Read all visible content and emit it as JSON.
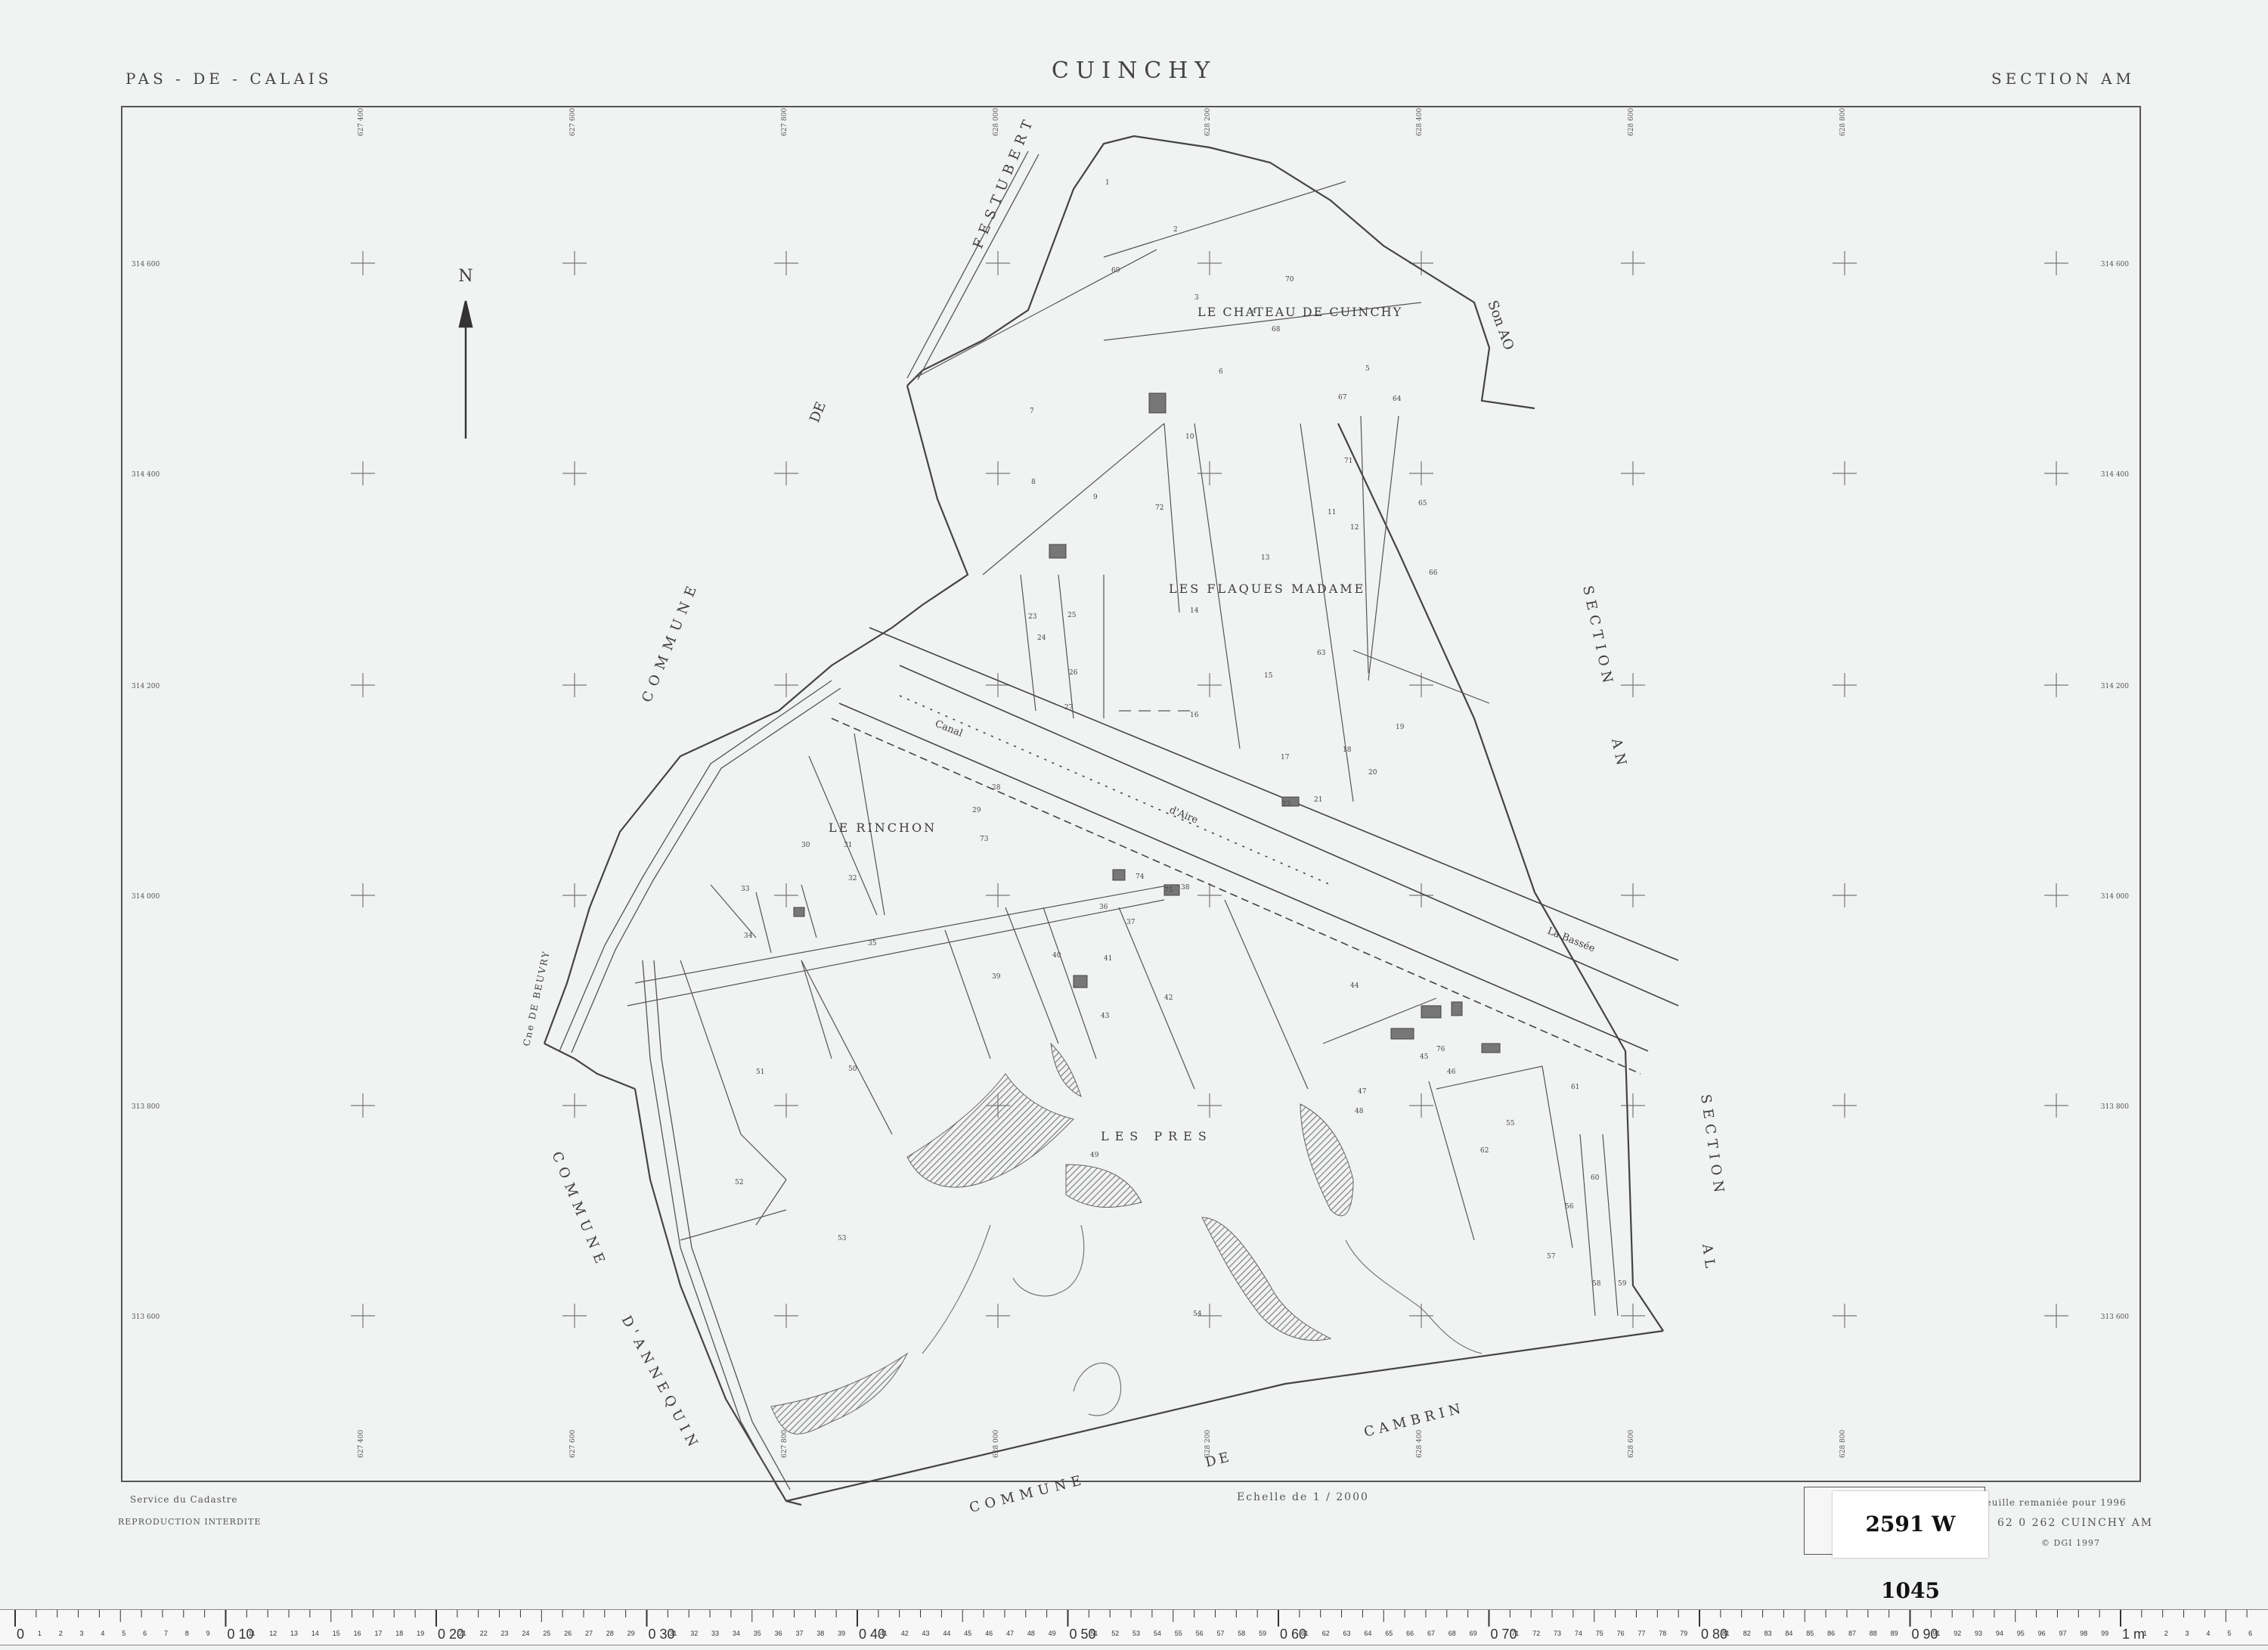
{
  "header": {
    "department": "PAS - DE - CALAIS",
    "commune": "CUINCHY",
    "section": "SECTION   AM"
  },
  "map": {
    "north_label": "N",
    "places": {
      "chateau": "LE CHATEAU DE CUINCHY",
      "flaques": "LES FLAQUES MADAME",
      "rinchon": "LE RINCHON",
      "pres": "LES PRES"
    },
    "neighbours": {
      "festubert_commune": "COMMUNE",
      "festubert_de": "DE",
      "festubert": "FESTUBERT",
      "section_ao": "Son AO",
      "section_an_word": "SECTION",
      "section_an": "AN",
      "section_al_word": "SECTION",
      "section_al": "AL",
      "annequin_commune": "COMMUNE",
      "annequin": "D'ANNEQUIN",
      "cambrin_commune": "COMMUNE",
      "cambrin_de": "DE",
      "cambrin": "CAMBRIN",
      "beuvry": "Cne DE BEUVRY"
    },
    "features": {
      "canal": "Canal",
      "aire": "d'Aire",
      "bassee": "La Bassée"
    },
    "grid_labels": {
      "x": [
        "627 400",
        "627 600",
        "627 800",
        "628 000",
        "628 200",
        "628 400",
        "628 600",
        "628 800"
      ],
      "y": [
        "314 600",
        "314 400",
        "314 200",
        "314 000",
        "313 800",
        "313 600"
      ]
    },
    "parcels": [
      "1",
      "2",
      "3",
      "4",
      "5",
      "6",
      "7",
      "8",
      "9",
      "10",
      "11",
      "12",
      "13",
      "14",
      "15",
      "16",
      "17",
      "18",
      "19",
      "20",
      "21",
      "22",
      "23",
      "24",
      "25",
      "26",
      "27",
      "28",
      "29",
      "30",
      "31",
      "32",
      "33",
      "34",
      "35",
      "36",
      "37",
      "38",
      "39",
      "40",
      "41",
      "42",
      "43",
      "44",
      "45",
      "46",
      "47",
      "48",
      "49",
      "50",
      "51",
      "52",
      "53",
      "54",
      "55",
      "56",
      "57",
      "58",
      "59",
      "60",
      "61",
      "62",
      "63",
      "64",
      "65",
      "66",
      "67",
      "68",
      "69",
      "70",
      "71",
      "72",
      "73",
      "74",
      "75",
      "76"
    ]
  },
  "footer": {
    "service": "Service du Cadastre",
    "reproduction": "REPRODUCTION INTERDITE",
    "scale": "Echelle de 1 / 2000",
    "remaniee": "Feuille remaniée pour 1996",
    "code": "62 0 262   CUINCHY   AM",
    "copyright": "© DGI   1997",
    "archive_stamp": "2591 W 1045"
  },
  "ruler": {
    "majors": [
      "0",
      "0 10",
      "0 20",
      "0 30",
      "0 40",
      "0 50",
      "0 60",
      "0 70",
      "0 80",
      "0 90",
      "1 m"
    ],
    "unit": "1 m"
  },
  "colors": {
    "ink": "#3a3a3a",
    "paper": "#f1f2f2",
    "hatch": "#8a8a8a",
    "ruler_red": "#c0392b"
  }
}
